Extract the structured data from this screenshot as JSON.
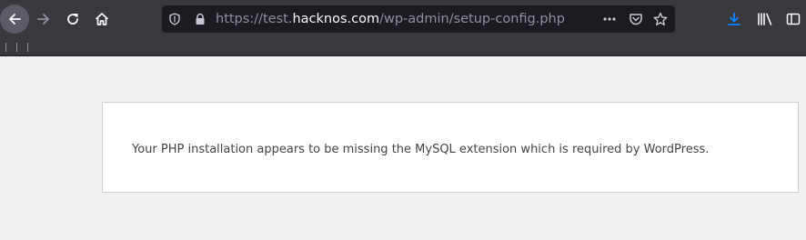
{
  "browser": {
    "url": {
      "prefix": "https://test.",
      "host": "hacknos.com",
      "path": "/wp-admin/setup-config.php"
    },
    "icons": {
      "back": "back-arrow-icon",
      "forward": "forward-arrow-icon",
      "reload": "reload-icon",
      "home": "home-icon",
      "shield": "tracking-protection-shield-icon",
      "lock": "lock-icon",
      "more": "page-actions-more-icon",
      "pocket": "pocket-icon",
      "star": "bookmark-star-icon",
      "download": "download-icon",
      "library": "library-icon",
      "sidebar": "sidebar-icon"
    },
    "colors": {
      "toolbar": "#38383d",
      "urlbar": "#1c1b22",
      "download_accent": "#0a84ff"
    }
  },
  "page": {
    "error_message": "Your PHP installation appears to be missing the MySQL extension which is required by WordPress."
  }
}
